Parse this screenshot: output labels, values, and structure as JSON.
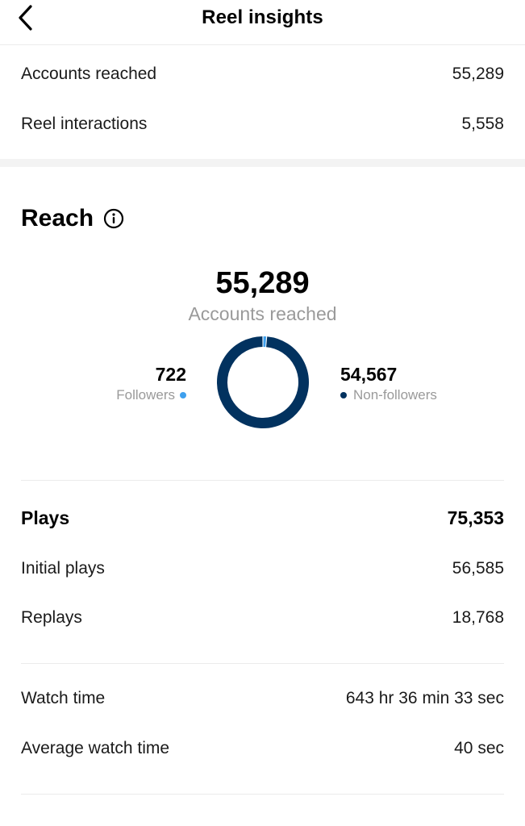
{
  "header": {
    "title": "Reel insights",
    "back_icon": "chevron-left-icon"
  },
  "summary": {
    "accounts_reached_label": "Accounts reached",
    "accounts_reached_value": "55,289",
    "reel_interactions_label": "Reel interactions",
    "reel_interactions_value": "5,558"
  },
  "reach": {
    "title": "Reach",
    "info_icon": "info-icon",
    "total": "55,289",
    "caption": "Accounts reached",
    "followers_value": "722",
    "followers_label": "Followers",
    "non_followers_value": "54,567",
    "non_followers_label": "Non-followers",
    "colors": {
      "followers": "#3ea0ee",
      "non_followers": "#02325f"
    }
  },
  "chart_data": {
    "type": "pie",
    "categories": [
      "Followers",
      "Non-followers"
    ],
    "values": [
      722,
      54567
    ],
    "title": "55,289"
  },
  "plays": {
    "title": "Plays",
    "total": "75,353",
    "initial_label": "Initial plays",
    "initial_value": "56,585",
    "replays_label": "Replays",
    "replays_value": "18,768"
  },
  "watch": {
    "watch_time_label": "Watch time",
    "watch_time_value": "643 hr 36 min 33 sec",
    "avg_label": "Average watch time",
    "avg_value": "40 sec"
  }
}
